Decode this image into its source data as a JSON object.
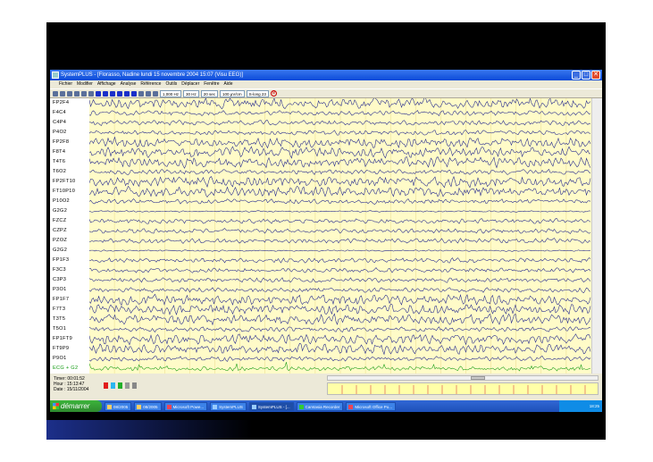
{
  "window": {
    "title": "SystemPLUS - [Florasso, Nadine lundi 15 novembre 2004 15:07 (Visu EEG)]",
    "controls": [
      "_",
      "□",
      "✕"
    ]
  },
  "menu": [
    "Fichier",
    "Modifier",
    "Affichage",
    "Analyse",
    "Référence",
    "Outils",
    "Déplacer",
    "Fenêtre",
    "Aide"
  ],
  "toolbar": {
    "filter_low": "1,000 Hz",
    "filter_high": "30 Hz",
    "timebase": "20 sec",
    "gain": "100 µV/cm",
    "montage": "S-long 23"
  },
  "channels": [
    "FP2F4",
    "F4C4",
    "C4P4",
    "P4O2",
    "FP2F8",
    "F8T4",
    "T4T6",
    "T6O2",
    "FP2FT10",
    "FT10P10",
    "P10O2",
    "G2G2",
    "FZCZ",
    "CZPZ",
    "PZOZ",
    "G2G2",
    "FP1F3",
    "F3C3",
    "C3P3",
    "P3O1",
    "FP1F7",
    "F7T3",
    "T3T5",
    "T5O1",
    "FP1FT9",
    "FT9P9",
    "P9O1",
    "ECG + G2"
  ],
  "info": {
    "timer": "Timer: 00:01:52",
    "hour": "Hour : 15:13:47",
    "date": "Date : 15/11/2004"
  },
  "taskbar": {
    "start": "démarrer",
    "tasks": [
      "08/2005",
      "08/2005",
      "Microsoft Powe...",
      "SystemPLUS",
      "SystemPLUS - [...",
      "Camtasia Recorder",
      "Microsoft Office Po..."
    ],
    "clock": "18:25"
  },
  "colors": {
    "trace": "#1a1f8c",
    "trace_ecg": "#119a11",
    "background": "#fffbc8",
    "titlebar": "#0a4ad8"
  }
}
